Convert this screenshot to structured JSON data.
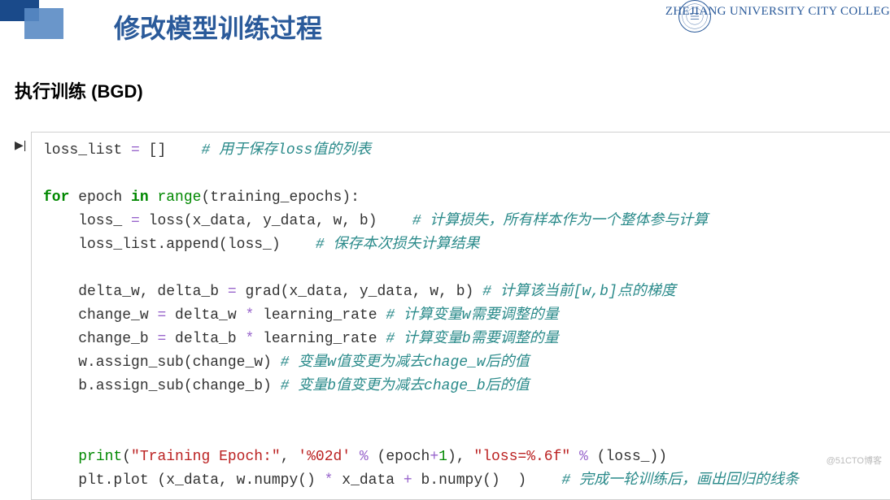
{
  "header": {
    "university": "ZHEJIANG UNIVERSITY CITY COLLEG",
    "slide_title": "修改模型训练过程"
  },
  "subtitle": "执行训练  (BGD)",
  "code": {
    "l1_a": "loss_list ",
    "l1_b": " []    ",
    "l1_c": "# 用于保存loss值的列表",
    "l2_for": "for",
    "l2_a": " epoch ",
    "l2_in": "in",
    "l2_sp": " ",
    "l2_range": "range",
    "l2_b": "(training_epochs):",
    "l3_a": "    loss_ ",
    "l3_b": " loss(x_data, y_data, w, b)    ",
    "l3_c": "# 计算损失，所有样本作为一个整体参与计算",
    "l4_a": "    loss_list.append(loss_)    ",
    "l4_c": "# 保存本次损失计算结果",
    "l5_a": "    delta_w, delta_b ",
    "l5_b": " grad(x_data, y_data, w, b) ",
    "l5_c": "# 计算该当前[w,b]点的梯度",
    "l6_a": "    change_w ",
    "l6_b": " delta_w ",
    "l6_c": " learning_rate ",
    "l6_d": "# 计算变量w需要调整的量",
    "l7_a": "    change_b ",
    "l7_b": " delta_b ",
    "l7_c": " learning_rate ",
    "l7_d": "# 计算变量b需要调整的量",
    "l8_a": "    w.assign_sub(change_w) ",
    "l8_c": "# 变量w值变更为减去chage_w后的值",
    "l9_a": "    b.assign_sub(change_b) ",
    "l9_c": "# 变量b值变更为减去chage_b后的值",
    "l10_pr": "print",
    "l10_a": "(",
    "l10_s1": "\"Training Epoch:\"",
    "l10_b": ", ",
    "l10_s2": "'%02d'",
    "l10_c": " ",
    "l10_pct": "%",
    "l10_d": " (epoch",
    "l10_plus": "+",
    "l10_one": "1",
    "l10_e": "), ",
    "l10_s3": "\"loss=%.6f\"",
    "l10_f": " ",
    "l10_g": " (loss_))",
    "l11_a": "    plt.plot (x_data, w.numpy() ",
    "l11_b": " x_data ",
    "l11_c": " b.numpy()  )    ",
    "l11_d": "# 完成一轮训练后，画出回归的线条",
    "ind": "    ",
    "eq": "=",
    "star": "*",
    "plus": "+"
  },
  "watermark": "@51CTO博客"
}
